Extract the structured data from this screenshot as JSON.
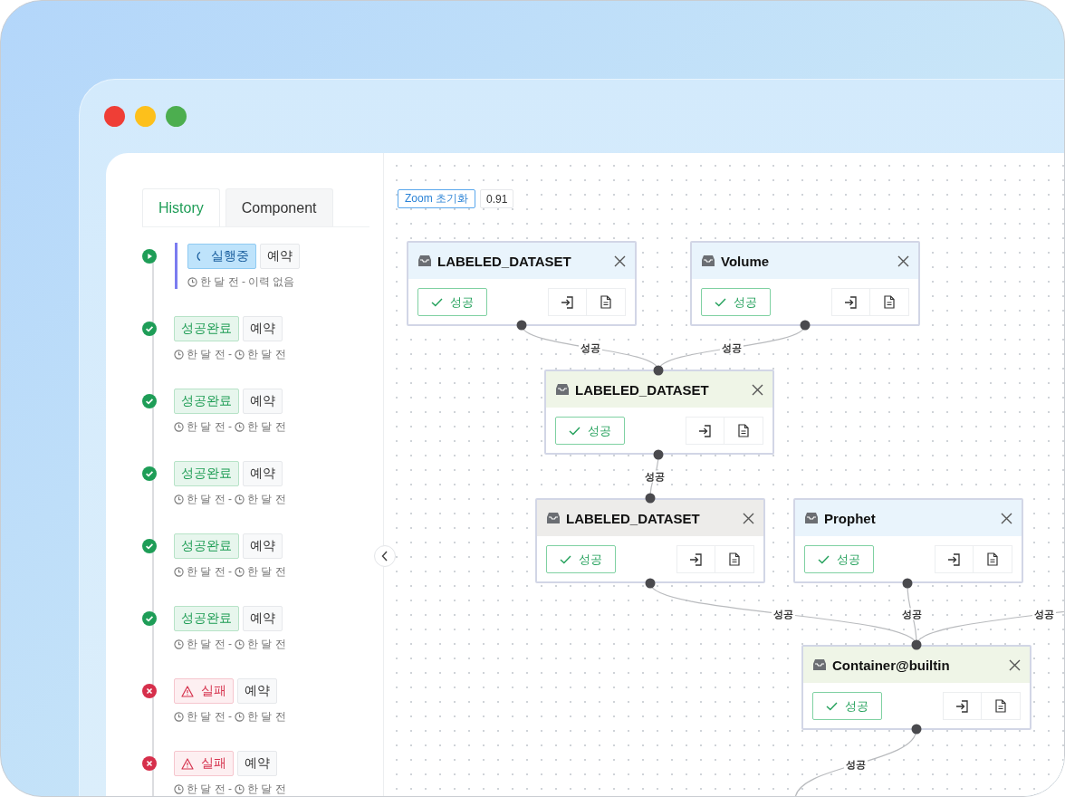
{
  "window_controls": [
    {
      "color": "#ef3e36"
    },
    {
      "color": "#fdc01b"
    },
    {
      "color": "#4cae4f"
    }
  ],
  "tabs": [
    {
      "label": "History",
      "selected": true
    },
    {
      "label": "Component",
      "selected": false
    }
  ],
  "history": [
    {
      "kind": "running",
      "status": "실행중",
      "tag": "예약",
      "start": "한 달 전 -",
      "end": "이력 없음",
      "selected": true
    },
    {
      "kind": "success",
      "status": "성공완료",
      "tag": "예약",
      "start": "한 달 전 -",
      "end": "한 달 전",
      "selected": false
    },
    {
      "kind": "success",
      "status": "성공완료",
      "tag": "예약",
      "start": "한 달 전 -",
      "end": "한 달 전",
      "selected": false
    },
    {
      "kind": "success",
      "status": "성공완료",
      "tag": "예약",
      "start": "한 달 전 -",
      "end": "한 달 전",
      "selected": false
    },
    {
      "kind": "success",
      "status": "성공완료",
      "tag": "예약",
      "start": "한 달 전 -",
      "end": "한 달 전",
      "selected": false
    },
    {
      "kind": "success",
      "status": "성공완료",
      "tag": "예약",
      "start": "한 달 전 -",
      "end": "한 달 전",
      "selected": false
    },
    {
      "kind": "failed",
      "status": "실패",
      "tag": "예약",
      "start": "한 달 전 -",
      "end": "한 달 전",
      "selected": false
    },
    {
      "kind": "failed",
      "status": "실패",
      "tag": "예약",
      "start": "한 달 전 -",
      "end": "한 달 전",
      "selected": false
    }
  ],
  "canvas": {
    "zoom_reset": "Zoom 초기화",
    "zoom": "0.91",
    "nodes": [
      {
        "title": "LABELED_DATASET",
        "color": "#e9f4fc",
        "status": "성공"
      },
      {
        "title": "Volume",
        "color": "#e9f4fc",
        "status": "성공"
      },
      {
        "title": "LABELED_DATASET",
        "color": "#eff5e7",
        "status": "성공"
      },
      {
        "title": "LABELED_DATASET",
        "color": "#edecea",
        "status": "성공"
      },
      {
        "title": "Prophet",
        "color": "#e9f4fc",
        "status": "성공"
      },
      {
        "title": "Container@builtin",
        "color": "#eff5e7",
        "status": "성공"
      }
    ],
    "edges": [
      {
        "label": "성공"
      },
      {
        "label": "성공"
      },
      {
        "label": "성공"
      },
      {
        "label": "성공"
      },
      {
        "label": "성공"
      },
      {
        "label": "성공"
      },
      {
        "label": "성공"
      }
    ]
  }
}
